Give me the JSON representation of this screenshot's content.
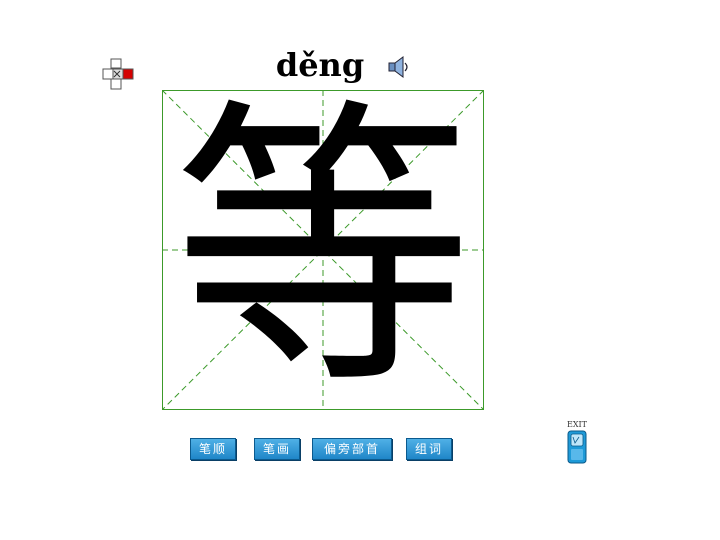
{
  "lesson": {
    "pinyin": "děng",
    "character": "等"
  },
  "icons": {
    "nav": "puzzle-icon",
    "sound": "speaker-icon",
    "exit": "exit-door-icon"
  },
  "buttons": [
    {
      "label": "笔顺"
    },
    {
      "label": "笔画"
    },
    {
      "label": "偏旁部首"
    },
    {
      "label": "组词"
    }
  ],
  "exit": {
    "label": "EXIT"
  },
  "colors": {
    "grid_line": "#3c9a2a",
    "button_bg": "#2a95d6"
  }
}
